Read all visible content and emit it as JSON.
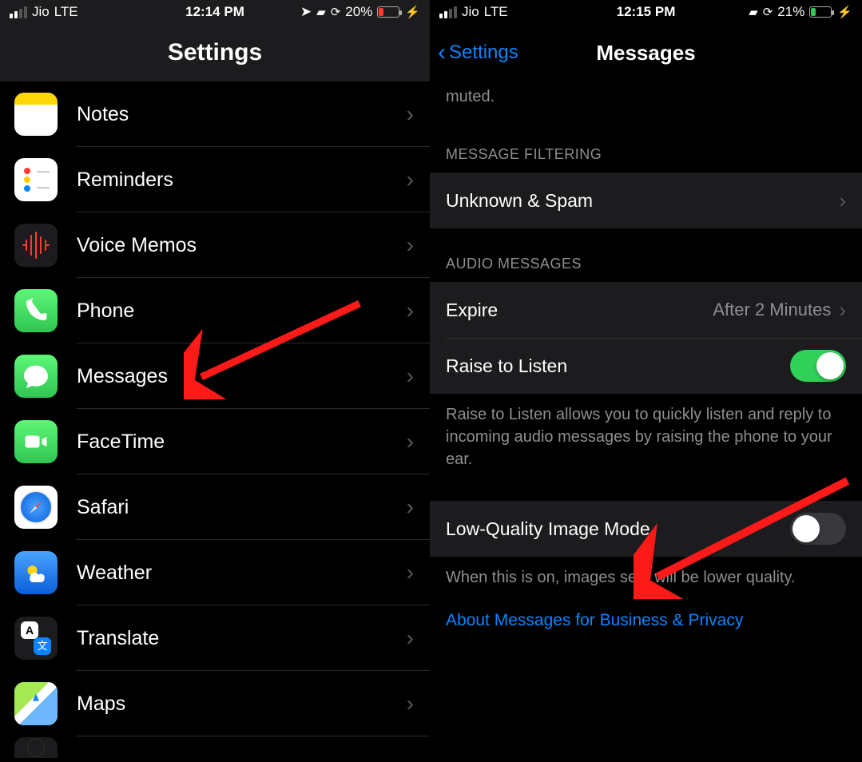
{
  "left": {
    "status": {
      "carrier": "Jio",
      "net": "LTE",
      "time": "12:14 PM",
      "battery_pct": "20%"
    },
    "title": "Settings",
    "items": [
      {
        "label": "Notes"
      },
      {
        "label": "Reminders"
      },
      {
        "label": "Voice Memos"
      },
      {
        "label": "Phone"
      },
      {
        "label": "Messages"
      },
      {
        "label": "FaceTime"
      },
      {
        "label": "Safari"
      },
      {
        "label": "Weather"
      },
      {
        "label": "Translate"
      },
      {
        "label": "Maps"
      }
    ]
  },
  "right": {
    "status": {
      "carrier": "Jio",
      "net": "LTE",
      "time": "12:15 PM",
      "battery_pct": "21%"
    },
    "back_label": "Settings",
    "title": "Messages",
    "top_trailing_text": "muted.",
    "section_filtering": "MESSAGE FILTERING",
    "row_unknown": "Unknown & Spam",
    "section_audio": "AUDIO MESSAGES",
    "row_expire_label": "Expire",
    "row_expire_value": "After 2 Minutes",
    "row_raise_label": "Raise to Listen",
    "raise_footer": "Raise to Listen allows you to quickly listen and reply to incoming audio messages by raising the phone to your ear.",
    "row_lowq_label": "Low-Quality Image Mode",
    "lowq_footer": "When this is on, images sent will be lower quality.",
    "link_about": "About Messages for Business & Privacy"
  }
}
